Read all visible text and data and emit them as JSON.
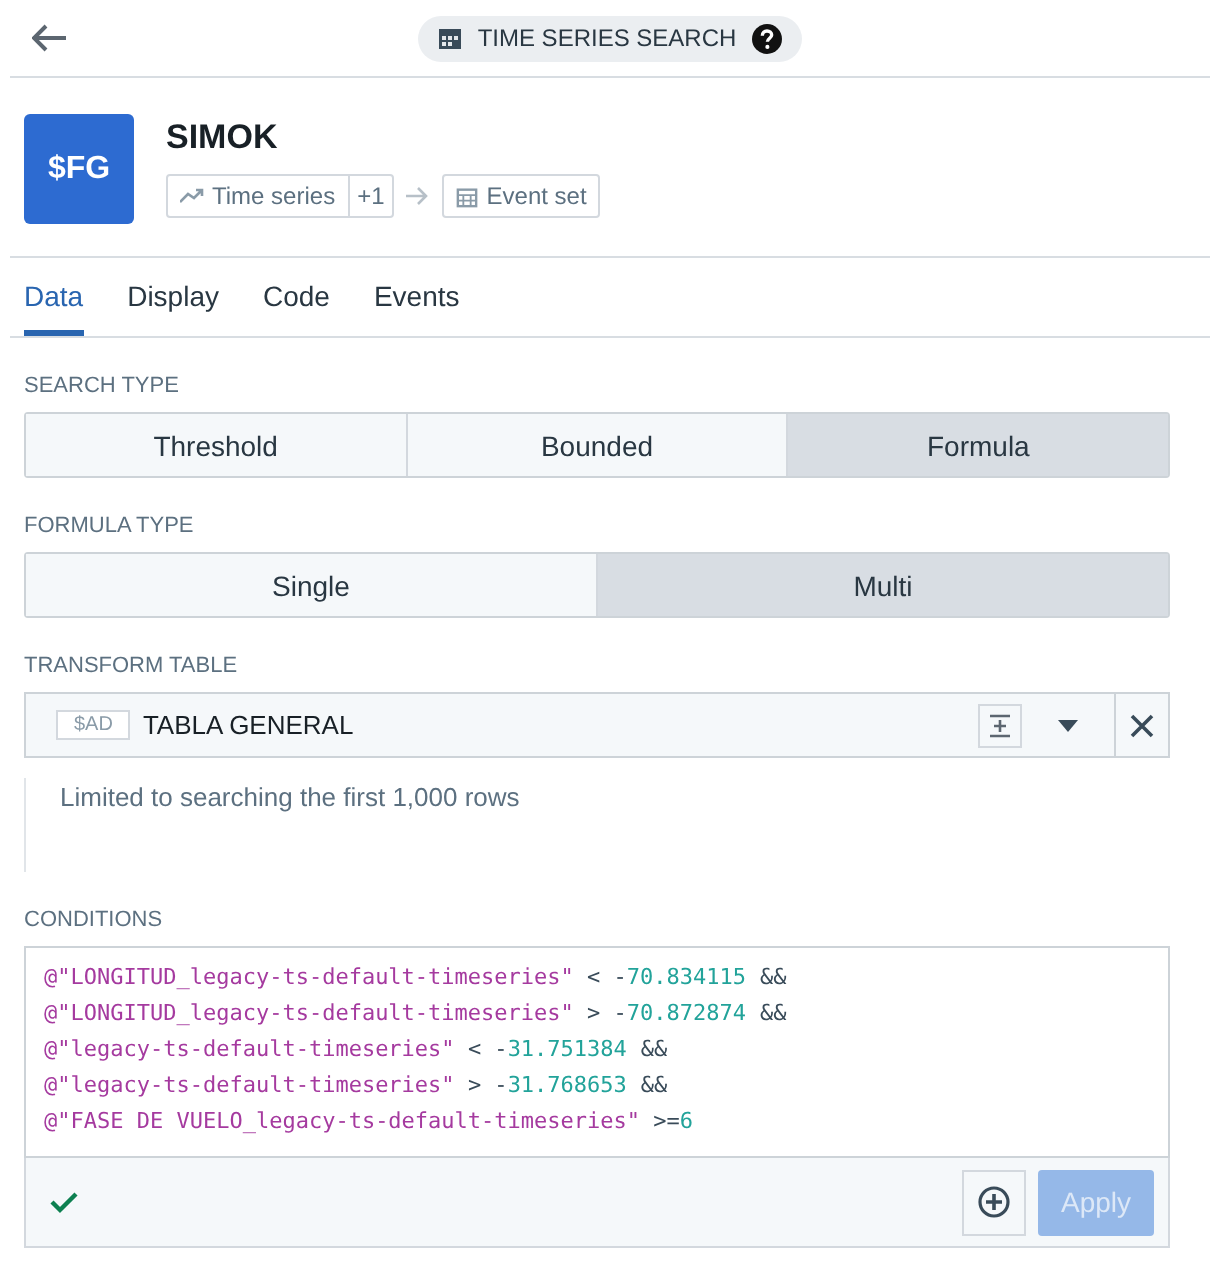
{
  "header": {
    "title": "TIME SERIES SEARCH"
  },
  "object": {
    "badge": "$FG",
    "name": "SIMOK",
    "input": "Time series",
    "input_extra": "+1",
    "output": "Event set"
  },
  "tabs": [
    {
      "label": "Data",
      "selected": true
    },
    {
      "label": "Display",
      "selected": false
    },
    {
      "label": "Code",
      "selected": false
    },
    {
      "label": "Events",
      "selected": false
    }
  ],
  "search_type": {
    "label": "SEARCH TYPE",
    "options": [
      {
        "label": "Threshold",
        "selected": false
      },
      {
        "label": "Bounded",
        "selected": false
      },
      {
        "label": "Formula",
        "selected": true
      }
    ]
  },
  "formula_type": {
    "label": "FORMULA TYPE",
    "options": [
      {
        "label": "Single",
        "selected": false
      },
      {
        "label": "Multi",
        "selected": true
      }
    ]
  },
  "transform_table": {
    "label": "TRANSFORM TABLE",
    "tag": "$AD",
    "value": "TABLA GENERAL",
    "note": "Limited to searching the first 1,000 rows"
  },
  "conditions": {
    "label": "CONDITIONS",
    "lines": [
      {
        "field": "@\"LONGITUD_legacy-ts-default-timeseries\"",
        "op": "< -",
        "value": "70.834115",
        "joiner": "&&"
      },
      {
        "field": "@\"LONGITUD_legacy-ts-default-timeseries\"",
        "op": "> -",
        "value": "70.872874",
        "joiner": "&&"
      },
      {
        "field": "@\"legacy-ts-default-timeseries\"",
        "op": "< -",
        "value": "31.751384",
        "joiner": "&&"
      },
      {
        "field": "@\"legacy-ts-default-timeseries\"",
        "op": "> -",
        "value": "31.768653",
        "joiner": "&&"
      },
      {
        "field": "@\"FASE DE VUELO_legacy-ts-default-timeseries\"",
        "op": ">=",
        "value": "6"
      }
    ],
    "valid": true,
    "apply": {
      "label": "Apply",
      "disabled": true
    }
  }
}
